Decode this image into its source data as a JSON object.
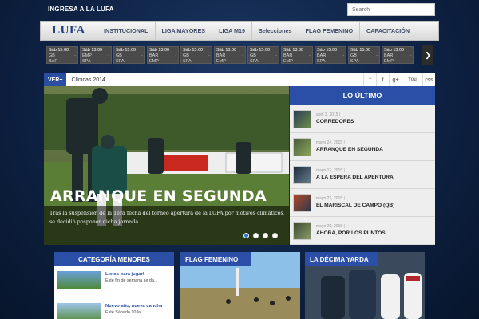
{
  "header": {
    "login_link": "INGRESA A LA LUFA",
    "search_placeholder": "Search"
  },
  "nav": {
    "logo": "LUFA",
    "items": [
      "INSTITUCIONAL",
      "LIGA MAYORES",
      "LIGA M19",
      "Selecciones",
      "FLAG FEMENINO",
      "CAPACITACIÓN"
    ]
  },
  "ticker": {
    "cards": [
      {
        "date": "Sáb 15:00",
        "home": "GB",
        "away": "BAR"
      },
      {
        "date": "Sáb 13:00",
        "home": "EMP",
        "away": "SPA"
      },
      {
        "date": "Sáb 15:00",
        "home": "GB",
        "away": "SPA"
      },
      {
        "date": "Sáb 13:00",
        "home": "BAR",
        "away": "EMP"
      },
      {
        "date": "Sáb 15:00",
        "home": "GB",
        "away": "SPA"
      },
      {
        "date": "Sáb 13:00",
        "home": "BAR",
        "away": "EMP"
      },
      {
        "date": "Sáb 15:00",
        "home": "GB",
        "away": "SPA"
      },
      {
        "date": "Sáb 13:00",
        "home": "BAR",
        "away": "EMP"
      },
      {
        "date": "Sáb 15:00",
        "home": "BAR",
        "away": "SPA"
      },
      {
        "date": "Sáb 15:00",
        "home": "GB",
        "away": "SPA"
      },
      {
        "date": "Sáb 13:00",
        "home": "BAR",
        "away": "EMP"
      }
    ],
    "next_symbol": "❯"
  },
  "verbar": {
    "label": "VER+",
    "text": "Clínicas 2014",
    "social": [
      "f",
      "t",
      "g+",
      "You",
      "rss"
    ]
  },
  "featured": {
    "title": "ARRANQUE EN SEGUNDA",
    "text": "Tras la suspensión de la 1era fecha del torneo apertura de la LUFA por motivos climáticos, se decidió posponer dicha jornada..."
  },
  "latest": {
    "heading": "LO ÚLTIMO",
    "items": [
      {
        "date": "abril 3, 2015 |",
        "title": "CORREDORES"
      },
      {
        "date": "mayo 24, 2015 |",
        "title": "ARRANQUE EN SEGUNDA"
      },
      {
        "date": "mayo 12, 2015 |",
        "title": "A LA ESPERA DEL APERTURA"
      },
      {
        "date": "mayo 22, 2015 |",
        "title": "EL MARISCAL DE CAMPO (QB)"
      },
      {
        "date": "mayo 21, 2015 |",
        "title": "AHORA, POR LOS PUNTOS"
      }
    ]
  },
  "panels": {
    "menores": {
      "heading": "CATEGORÍA MENORES",
      "items": [
        {
          "title": "Listos para jugar!",
          "text": "Este fin de semana se da..."
        },
        {
          "title": "Nuevo año, nueva cancha",
          "text": "Este Sábado 10 la"
        }
      ]
    },
    "flag": {
      "heading": "FLAG FEMENINO"
    },
    "yarda": {
      "heading": "LA DÉCIMA YARDA"
    }
  },
  "colors": {
    "brand_blue": "#2b4fa6",
    "background": "#0e2244"
  }
}
